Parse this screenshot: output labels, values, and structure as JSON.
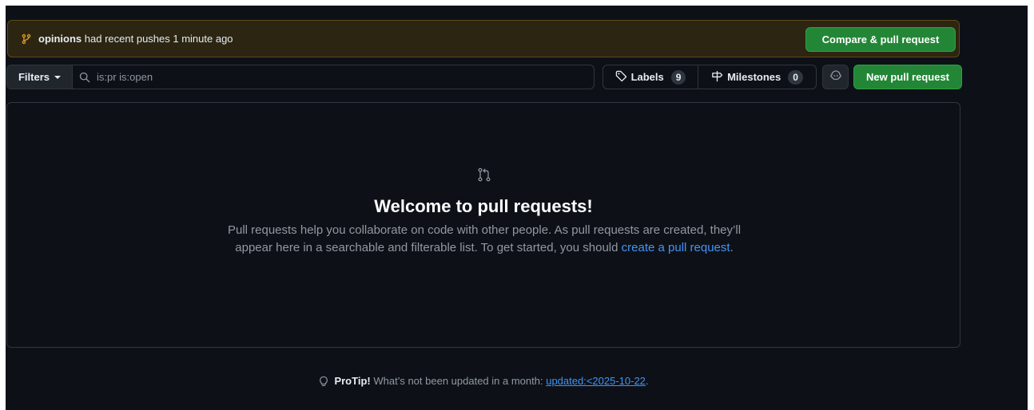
{
  "banner": {
    "branch": "opinions",
    "message": "had recent pushes 1 minute ago",
    "compare_button": "Compare & pull request",
    "branch_icon": "git-branch-icon"
  },
  "filters": {
    "button_label": "Filters",
    "search_value": "is:pr is:open",
    "search_icon": "search-icon"
  },
  "labels": {
    "label": "Labels",
    "count": "9",
    "icon": "tag-icon"
  },
  "milestones": {
    "label": "Milestones",
    "count": "0",
    "icon": "milestone-icon"
  },
  "copilot_icon": "copilot-icon",
  "new_pr_button": "New pull request",
  "blankslate": {
    "icon": "git-pull-request-icon",
    "title": "Welcome to pull requests!",
    "desc_before": "Pull requests help you collaborate on code with other people. As pull requests are created, they’ll appear here in a searchable and filterable list. To get started, you should ",
    "link": "create a pull request",
    "desc_after": "."
  },
  "protip": {
    "icon": "light-bulb-icon",
    "label": "ProTip!",
    "text": "What’s not been updated in a month:",
    "link": "updated:<2025-10-22",
    "end": "."
  },
  "colors": {
    "background": "#0d1117",
    "banner_bg": "#2c2511",
    "banner_border": "#5f4a16",
    "primary_button": "#238636",
    "link": "#4493f8",
    "border": "#30363d",
    "muted_text": "#9198a1"
  }
}
